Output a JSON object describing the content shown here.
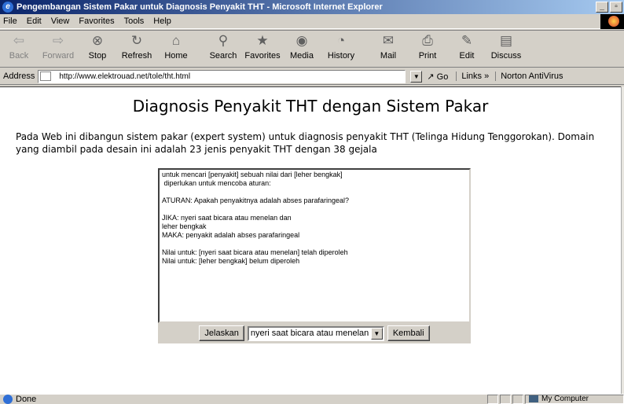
{
  "window": {
    "title": "Pengembangan Sistem Pakar untuk Diagnosis Penyakit THT - Microsoft Internet Explorer",
    "min": "_",
    "max": "▫",
    "app_icon": "e"
  },
  "menubar": {
    "items": [
      "File",
      "Edit",
      "View",
      "Favorites",
      "Tools",
      "Help"
    ]
  },
  "toolbar": {
    "buttons": [
      {
        "label": "Back",
        "icon": "back-arrow-icon",
        "glyph": "⇦"
      },
      {
        "label": "Forward",
        "icon": "forward-arrow-icon",
        "glyph": "⇨"
      },
      {
        "label": "Stop",
        "icon": "stop-icon",
        "glyph": "⊗"
      },
      {
        "label": "Refresh",
        "icon": "refresh-icon",
        "glyph": "↻"
      },
      {
        "label": "Home",
        "icon": "home-icon",
        "glyph": "⌂"
      },
      {
        "label": "Search",
        "icon": "search-icon",
        "glyph": "⚲"
      },
      {
        "label": "Favorites",
        "icon": "favorites-icon",
        "glyph": "★"
      },
      {
        "label": "Media",
        "icon": "media-icon",
        "glyph": "◉"
      },
      {
        "label": "History",
        "icon": "history-icon",
        "glyph": "◔"
      },
      {
        "label": "Mail",
        "icon": "mail-icon",
        "glyph": "✉"
      },
      {
        "label": "Print",
        "icon": "print-icon",
        "glyph": "⎙"
      },
      {
        "label": "Edit",
        "icon": "edit-icon",
        "glyph": "✎"
      },
      {
        "label": "Discuss",
        "icon": "discuss-icon",
        "glyph": "▤"
      }
    ]
  },
  "addressbar": {
    "label": "Address",
    "url": "http://www.elektrouad.net/tole/tht.html",
    "go": "Go",
    "links": "Links »",
    "norton": "Norton AntiVirus"
  },
  "page": {
    "heading": "Diagnosis Penyakit THT dengan Sistem Pakar",
    "intro": "Pada Web ini dibangun sistem pakar (expert system) untuk diagnosis penyakit THT  (Telinga Hidung Tenggorokan). Domain yang diambil pada desain ini adalah 23 jenis penyakit THT dengan 38 gejala",
    "console_lines": [
      "untuk mencari [penyakit] sebuah nilai dari [leher bengkak]",
      " diperlukan untuk mencoba aturan:",
      "",
      "ATURAN: Apakah penyakitnya adalah abses parafaringeal?",
      "",
      "JIKA: nyeri saat bicara atau menelan dan",
      "leher bengkak",
      "MAKA: penyakit adalah abses parafaringeal",
      "",
      "Nilai untuk: [nyeri saat bicara atau menelan] telah diperoleh",
      "Nilai untuk: [leher bengkak] belum diperoleh"
    ],
    "buttons": {
      "explain": "Jelaskan",
      "back": "Kembali"
    },
    "select_value": "nyeri saat bicara atau menelan"
  },
  "statusbar": {
    "text": "Done",
    "zone": "My Computer"
  }
}
